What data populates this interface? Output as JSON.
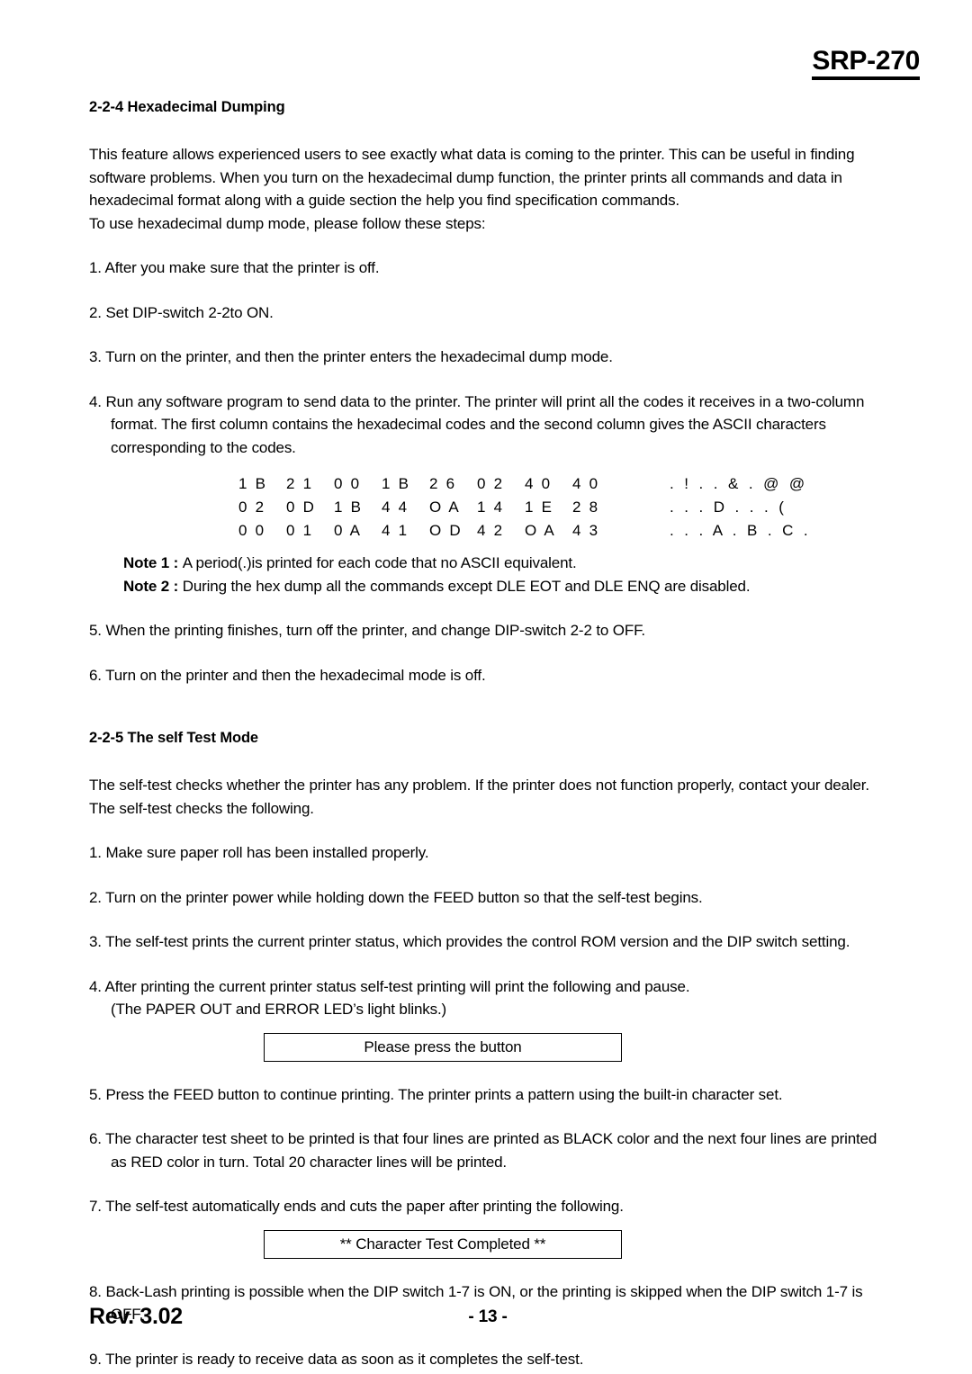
{
  "header": {
    "model_title": "SRP-270"
  },
  "section_hex": {
    "heading": "2-2-4 Hexadecimal Dumping",
    "intro_line1": "This feature allows experienced users to see exactly what data is coming to the printer. This can be useful in finding software problems. When you turn on the hexadecimal dump function, the printer prints all commands and data in hexadecimal format along with a guide section the help you find specification commands.",
    "intro_line2": "To use hexadecimal dump mode, please follow these steps:",
    "steps": [
      "1. After you make sure that the printer is off.",
      "2. Set DIP-switch 2-2to ON.",
      "3. Turn on the printer, and then the printer enters the hexadecimal dump mode.",
      "4. Run any software program to send data to the printer. The printer will print all the codes it receives in a two-column format. The first column contains the hexadecimal codes and the second column gives the ASCII characters corresponding to the codes."
    ],
    "hex_dump": {
      "rows": [
        {
          "hex": [
            "1 B",
            "2 1",
            "0 0",
            "1 B",
            "2 6",
            "0 2",
            "4 0",
            "4 0"
          ],
          "ascii": ". ! . . & . @ @"
        },
        {
          "hex": [
            "0 2",
            "0 D",
            "1 B",
            "4 4",
            "O A",
            "1 4",
            "1 E",
            "2 8"
          ],
          "ascii": ". . . D . . . ("
        },
        {
          "hex": [
            "0 0",
            "0 1",
            "0 A",
            "4 1",
            "O D",
            "4 2",
            "O A",
            "4 3"
          ],
          "ascii": ". . . A . B . C ."
        }
      ]
    },
    "notes": [
      {
        "label": "Note 1 : ",
        "text": "A period(.)is printed for each code that no ASCII equivalent."
      },
      {
        "label": "Note 2 : ",
        "text": "During the hex dump all the commands except DLE EOT and DLE ENQ are disabled."
      }
    ],
    "steps_after": [
      "5. When the printing finishes, turn off the printer, and change DIP-switch 2-2 to OFF.",
      "6. Turn on the printer and then the hexadecimal mode is off."
    ]
  },
  "section_selftest": {
    "heading": "2-2-5 The self Test Mode",
    "intro": "The self-test checks whether the printer has any problem. If the printer does not function properly, contact your dealer. The self-test checks the following.",
    "step1": "1. Make sure paper roll has been installed properly.",
    "step2": "2. Turn on the printer power while holding down the FEED button so that the self-test begins.",
    "step3": "3. The self-test prints the current printer status, which provides the control ROM version and the DIP switch setting.",
    "step4_line1": "4. After printing the current printer status self-test printing will print the following and pause.",
    "step4_line2": "(The PAPER OUT and ERROR LED’s light blinks.)",
    "box1_text": "Please press the button",
    "step5": "5. Press the FEED button to continue printing. The printer prints a pattern using the built-in character set.",
    "step6": "6. The character test sheet to be printed is that four lines are printed as BLACK color and the next four lines are printed as RED color in turn. Total 20 character lines will be printed.",
    "step7": "7. The self-test automatically ends and cuts the paper after printing the following.",
    "box2_text": "** Character Test Completed **",
    "step8": "8. Back-Lash printing is possible when the DIP switch 1-7 is ON, or the printing is skipped when the DIP switch 1-7 is OFF.",
    "step9": "9. The printer is ready to receive data as soon as it completes the self-test."
  },
  "footer": {
    "revision": "Rev. 3.02",
    "page_number": "- 13 -"
  }
}
